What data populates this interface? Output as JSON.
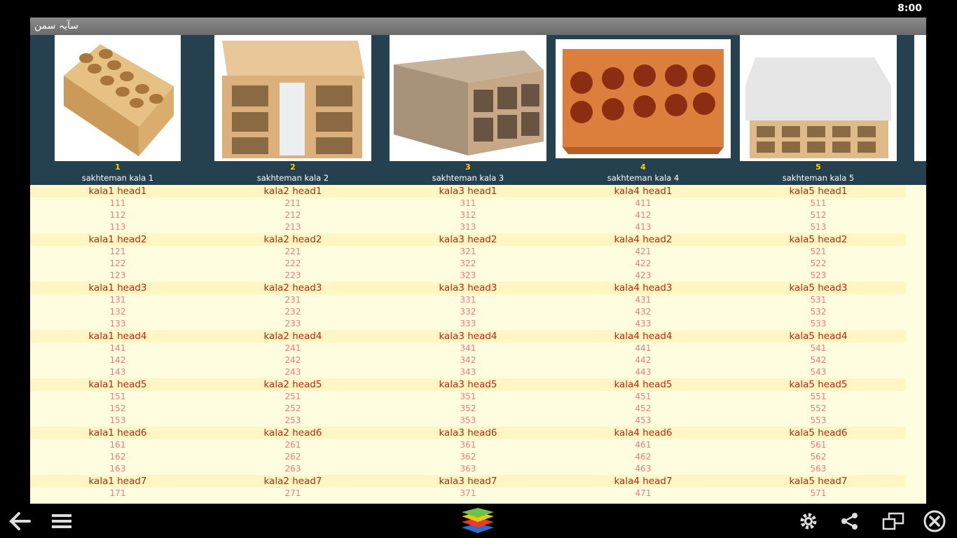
{
  "status": {
    "clock": "8:00"
  },
  "app": {
    "title": "سآيہ سمن"
  },
  "products": [
    {
      "number": "1",
      "caption": "sakhteman kala 1",
      "image": "brick-perforated-icon"
    },
    {
      "number": "2",
      "caption": "sakhteman kala 2",
      "image": "block-insulated-icon"
    },
    {
      "number": "3",
      "caption": "sakhteman kala 3",
      "image": "block-hollow-icon"
    },
    {
      "number": "4",
      "caption": "sakhteman kala 4",
      "image": "brick-red-icon"
    },
    {
      "number": "5",
      "caption": "sakhteman kala 5",
      "image": "block-foam-icon"
    }
  ],
  "columns": [
    {
      "heads": [
        {
          "label": "kala1 head1",
          "values": [
            "111",
            "112",
            "113"
          ]
        },
        {
          "label": "kala1 head2",
          "values": [
            "121",
            "122",
            "123"
          ]
        },
        {
          "label": "kala1 head3",
          "values": [
            "131",
            "132",
            "133"
          ]
        },
        {
          "label": "kala1 head4",
          "values": [
            "141",
            "142",
            "143"
          ]
        },
        {
          "label": "kala1 head5",
          "values": [
            "151",
            "152",
            "153"
          ]
        },
        {
          "label": "kala1 head6",
          "values": [
            "161",
            "162",
            "163"
          ]
        },
        {
          "label": "kala1 head7",
          "values": [
            "171"
          ]
        }
      ]
    },
    {
      "heads": [
        {
          "label": "kala2 head1",
          "values": [
            "211",
            "212",
            "213"
          ]
        },
        {
          "label": "kala2 head2",
          "values": [
            "221",
            "222",
            "223"
          ]
        },
        {
          "label": "kala2 head3",
          "values": [
            "231",
            "232",
            "233"
          ]
        },
        {
          "label": "kala2 head4",
          "values": [
            "241",
            "242",
            "243"
          ]
        },
        {
          "label": "kala2 head5",
          "values": [
            "251",
            "252",
            "253"
          ]
        },
        {
          "label": "kala2 head6",
          "values": [
            "261",
            "262",
            "263"
          ]
        },
        {
          "label": "kala2 head7",
          "values": [
            "271"
          ]
        }
      ]
    },
    {
      "heads": [
        {
          "label": "kala3 head1",
          "values": [
            "311",
            "312",
            "313"
          ]
        },
        {
          "label": "kala3 head2",
          "values": [
            "321",
            "322",
            "323"
          ]
        },
        {
          "label": "kala3 head3",
          "values": [
            "331",
            "332",
            "333"
          ]
        },
        {
          "label": "kala3 head4",
          "values": [
            "341",
            "342",
            "343"
          ]
        },
        {
          "label": "kala3 head5",
          "values": [
            "351",
            "352",
            "353"
          ]
        },
        {
          "label": "kala3 head6",
          "values": [
            "361",
            "362",
            "363"
          ]
        },
        {
          "label": "kala3 head7",
          "values": [
            "371"
          ]
        }
      ]
    },
    {
      "heads": [
        {
          "label": "kala4 head1",
          "values": [
            "411",
            "412",
            "413"
          ]
        },
        {
          "label": "kala4 head2",
          "values": [
            "421",
            "422",
            "423"
          ]
        },
        {
          "label": "kala4 head3",
          "values": [
            "431",
            "432",
            "433"
          ]
        },
        {
          "label": "kala4 head4",
          "values": [
            "441",
            "442",
            "443"
          ]
        },
        {
          "label": "kala4 head5",
          "values": [
            "451",
            "452",
            "453"
          ]
        },
        {
          "label": "kala4 head6",
          "values": [
            "461",
            "462",
            "463"
          ]
        },
        {
          "label": "kala4 head7",
          "values": [
            "471"
          ]
        }
      ]
    },
    {
      "heads": [
        {
          "label": "kala5 head1",
          "values": [
            "511",
            "512",
            "513"
          ]
        },
        {
          "label": "kala5 head2",
          "values": [
            "521",
            "522",
            "523"
          ]
        },
        {
          "label": "kala5 head3",
          "values": [
            "531",
            "532",
            "533"
          ]
        },
        {
          "label": "kala5 head4",
          "values": [
            "541",
            "542",
            "543"
          ]
        },
        {
          "label": "kala5 head5",
          "values": [
            "551",
            "552",
            "553"
          ]
        },
        {
          "label": "kala5 head6",
          "values": [
            "561",
            "562",
            "563"
          ]
        },
        {
          "label": "kala5 head7",
          "values": [
            "571"
          ]
        }
      ]
    }
  ],
  "taskbar": {
    "icons": [
      "back-arrow-icon",
      "menu-icon",
      "bluestacks-logo-icon",
      "settings-gear-icon",
      "share-icon",
      "window-toggle-icon",
      "close-circle-icon"
    ]
  }
}
